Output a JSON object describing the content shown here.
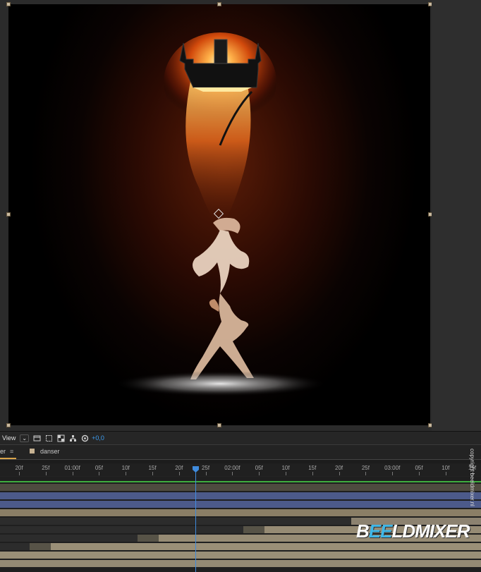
{
  "viewer": {
    "toolbar": {
      "view_label": "View",
      "chevron": "⌄",
      "exposure_value": "+0,0",
      "icons": [
        "view-options-icon",
        "region-of-interest-icon",
        "transparency-grid-icon",
        "flowchart-icon",
        "reset-exposure-icon"
      ]
    }
  },
  "timeline": {
    "tab_label": "er",
    "tab_menu": "≡",
    "layer_name": "danser",
    "layer_label_color": "#c7b292",
    "ruler_labels": [
      "20f",
      "25f",
      "01:00f",
      "05f",
      "10f",
      "15f",
      "20f",
      "25f",
      "02:00f",
      "05f",
      "10f",
      "15f",
      "20f",
      "25f",
      "03:00f",
      "05f",
      "10f",
      "15f"
    ],
    "playhead_color": "#3f8bdd"
  },
  "watermark": {
    "copyright": "copyright beeldmixer.nl",
    "logo_text_a": "B",
    "logo_text_tv": "EE",
    "logo_text_b": "LDMIXER"
  }
}
